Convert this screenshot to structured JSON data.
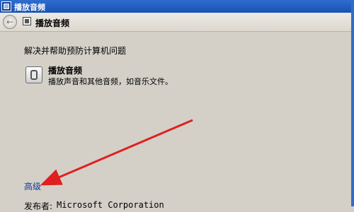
{
  "window": {
    "title": "播放音频"
  },
  "nav": {
    "title": "播放音频",
    "back_icon": "back-arrow-icon"
  },
  "content": {
    "heading": "解决并帮助预防计算机问题",
    "item": {
      "title": "播放音频",
      "description": "播放声音和其他音频，如音乐文件。",
      "icon": "speaker-icon"
    },
    "advanced_link": "高级",
    "publisher_label": "发布者:",
    "publisher_value": "Microsoft Corporation"
  },
  "annotation": {
    "arrow_color": "#e02020"
  }
}
